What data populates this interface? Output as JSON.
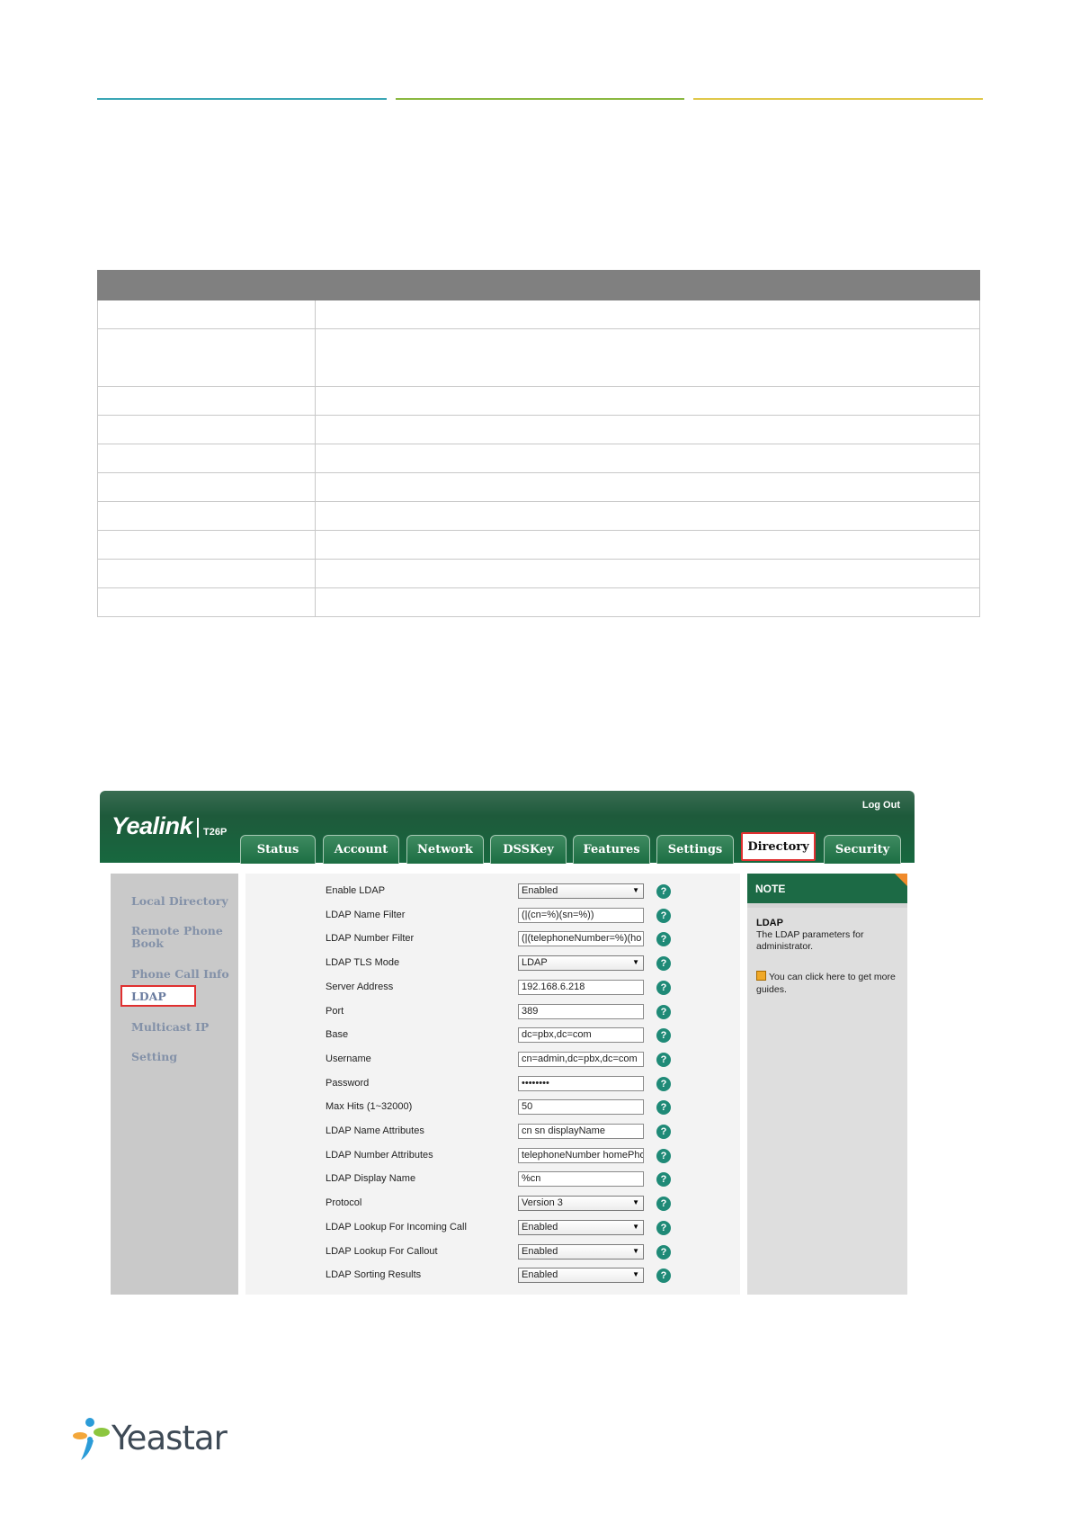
{
  "colors": {
    "rule1": "#3aa6b5",
    "rule2": "#8ab840",
    "rule3": "#e0c84a",
    "phone_green": "#1e6a42",
    "highlight_red": "#e03030"
  },
  "table": {
    "rows": [
      [
        "",
        ""
      ],
      [
        "",
        ""
      ],
      [
        "",
        ""
      ],
      [
        "",
        ""
      ],
      [
        "",
        ""
      ],
      [
        "",
        ""
      ],
      [
        "",
        ""
      ],
      [
        "",
        ""
      ],
      [
        "",
        ""
      ],
      [
        "",
        ""
      ]
    ]
  },
  "phone": {
    "brand": "Yealink",
    "model": "T26P",
    "logout": "Log Out",
    "tabs": [
      "Status",
      "Account",
      "Network",
      "DSSKey",
      "Features",
      "Settings",
      "Directory",
      "Security"
    ],
    "active_tab": "Directory",
    "nav": [
      "Local Directory",
      "Remote Phone Book",
      "Phone Call Info",
      "LDAP",
      "Multicast IP",
      "Setting"
    ],
    "active_nav": "LDAP",
    "fields": [
      {
        "label": "Enable LDAP",
        "value": "Enabled",
        "type": "select"
      },
      {
        "label": "LDAP Name Filter",
        "value": "(|(cn=%)(sn=%))",
        "type": "input"
      },
      {
        "label": "LDAP Number Filter",
        "value": "(|(telephoneNumber=%)(ho",
        "type": "input"
      },
      {
        "label": "LDAP TLS Mode",
        "value": "LDAP",
        "type": "select"
      },
      {
        "label": "Server Address",
        "value": "192.168.6.218",
        "type": "input"
      },
      {
        "label": "Port",
        "value": "389",
        "type": "input"
      },
      {
        "label": "Base",
        "value": "dc=pbx,dc=com",
        "type": "input"
      },
      {
        "label": "Username",
        "value": "cn=admin,dc=pbx,dc=com",
        "type": "input"
      },
      {
        "label": "Password",
        "value": "••••••••",
        "type": "input"
      },
      {
        "label": "Max Hits (1~32000)",
        "value": "50",
        "type": "input"
      },
      {
        "label": "LDAP Name Attributes",
        "value": "cn sn displayName",
        "type": "input"
      },
      {
        "label": "LDAP Number Attributes",
        "value": "telephoneNumber homePhon",
        "type": "input"
      },
      {
        "label": "LDAP Display Name",
        "value": "%cn",
        "type": "input"
      },
      {
        "label": "Protocol",
        "value": "Version 3",
        "type": "select"
      },
      {
        "label": "LDAP Lookup For Incoming Call",
        "value": "Enabled",
        "type": "select"
      },
      {
        "label": "LDAP Lookup For Callout",
        "value": "Enabled",
        "type": "select"
      },
      {
        "label": "LDAP Sorting Results",
        "value": "Enabled",
        "type": "select"
      }
    ],
    "help_glyph": "?",
    "note": {
      "heading": "NOTE",
      "title": "LDAP",
      "text": "The LDAP parameters for administrator.",
      "guide": "You can click here to get more guides."
    }
  },
  "footer": {
    "logo_text": "Yeastar"
  }
}
